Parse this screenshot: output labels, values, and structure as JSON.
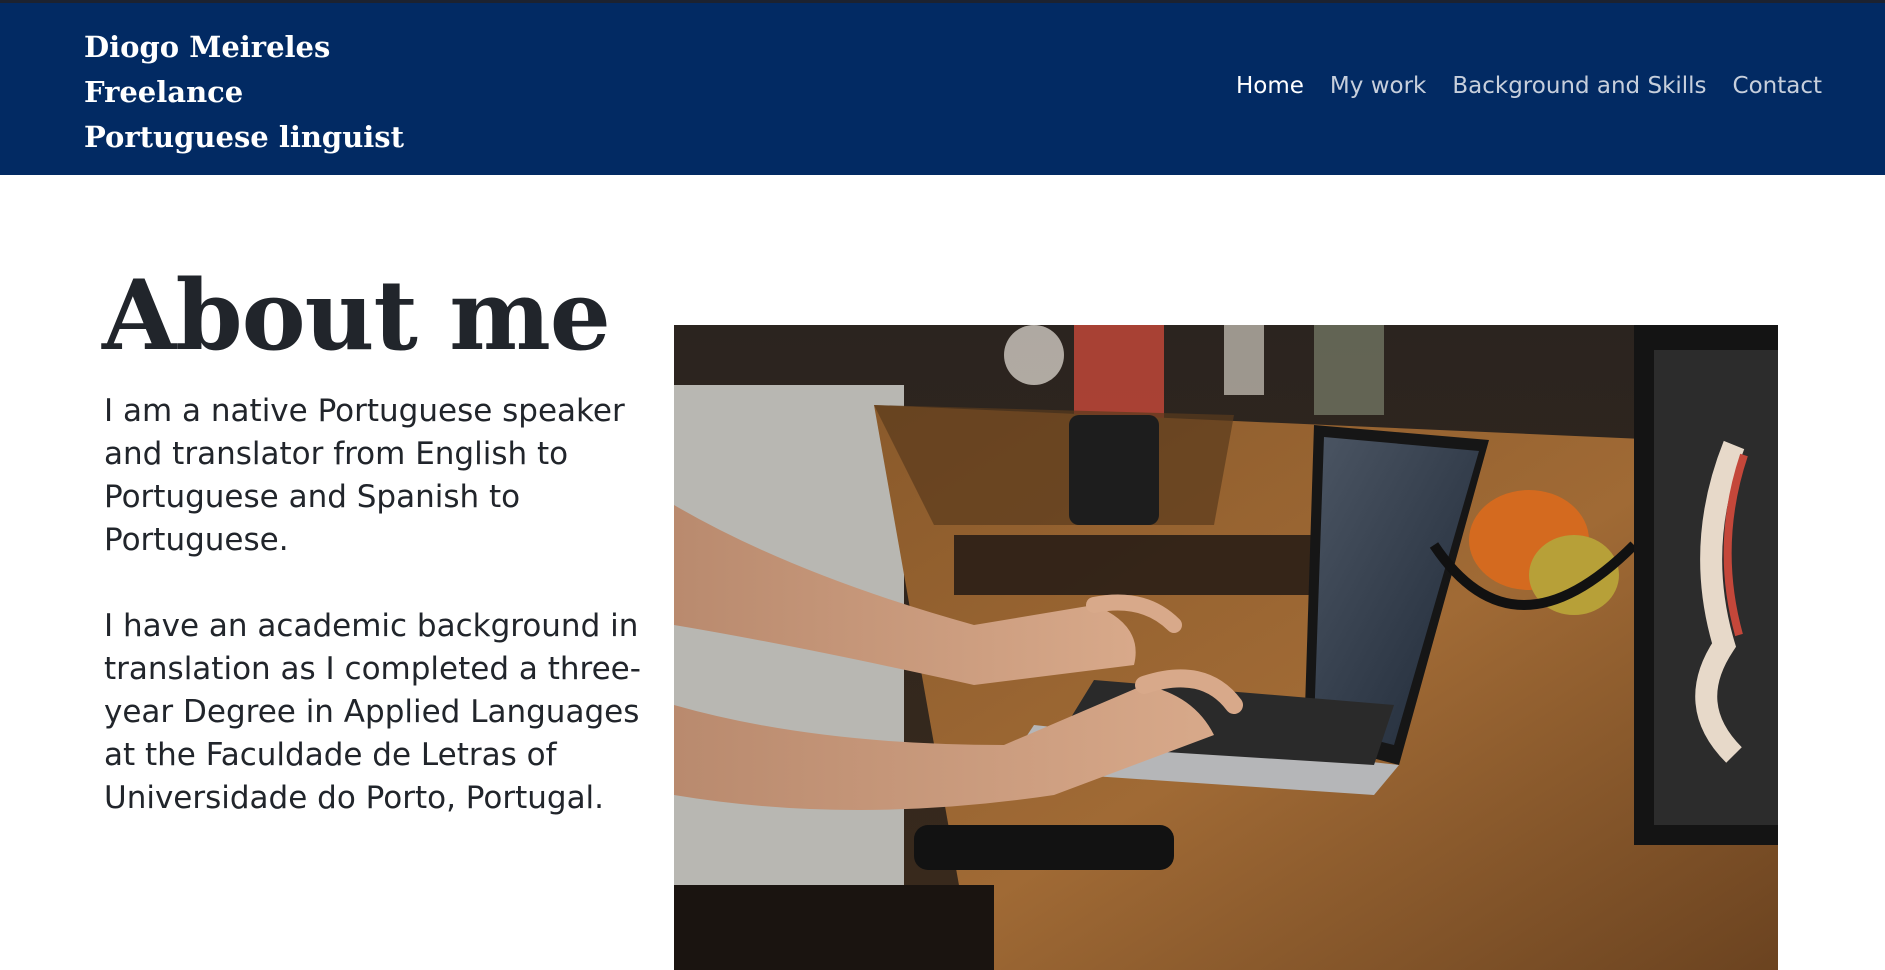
{
  "header": {
    "brand_lines": [
      "Diogo Meireles",
      "Freelance",
      "Portuguese linguist"
    ],
    "nav": [
      "Home",
      "My work",
      "Background and Skills",
      "Contact"
    ],
    "active_nav": "Home"
  },
  "main": {
    "title": "About me",
    "paragraphs": [
      "I am a native Portuguese speaker and translator from English to Portuguese and Spanish to Portuguese.",
      "I have an academic background in translation as I completed a three-year Degree in Applied Languages at the Faculdade de Letras of Universidade do Porto, Portugal."
    ],
    "photo_icon": "laptop-photo"
  },
  "colors": {
    "header_bg": "#022a63",
    "nav_active": "#ffffff",
    "nav_inactive": "#c7cfdc",
    "text": "#21252b"
  }
}
